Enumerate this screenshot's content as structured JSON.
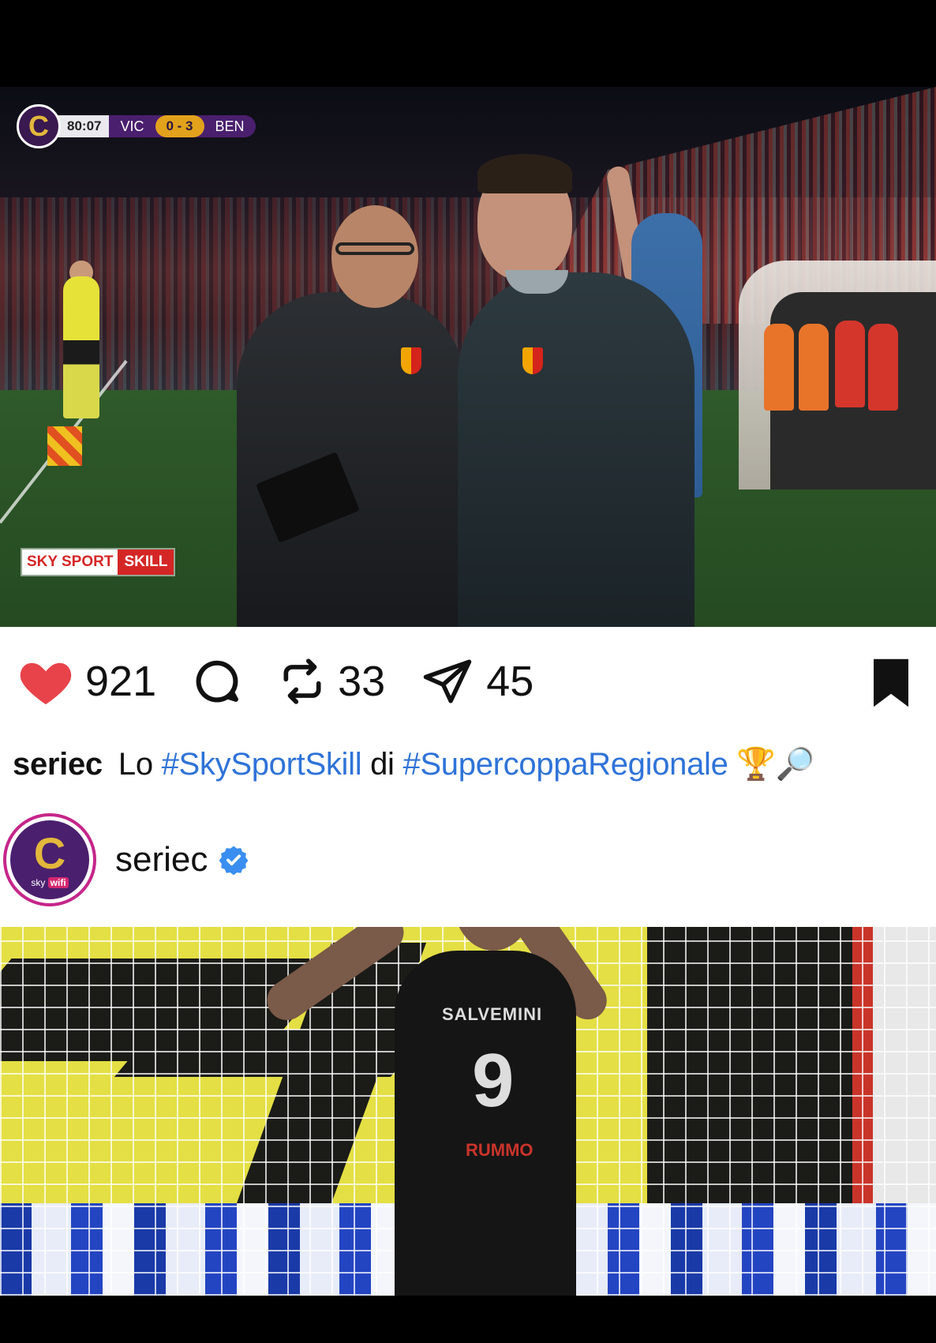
{
  "scoreboard": {
    "time": "80:07",
    "home": "VIC",
    "score": "0 - 3",
    "away": "BEN"
  },
  "broadcaster": {
    "part1": "SKY SPORT",
    "part2": "SKILL"
  },
  "actions": {
    "likes": "921",
    "reposts": "33",
    "shares": "45",
    "like_color": "#e8434a"
  },
  "caption": {
    "username": "seriec",
    "text1": "Lo",
    "hashtag1": "#SkySportSkill",
    "text2": "di",
    "hashtag2": "#SupercoppaRegionale",
    "emojis": "🏆🔎",
    "hashtag_color": "#2f73d8"
  },
  "profile": {
    "username": "seriec",
    "avatar_letter": "C",
    "avatar_sub": "sky",
    "avatar_sub2": "wifi",
    "verified": true
  },
  "photo": {
    "jersey_name": "SALVEMINI",
    "jersey_number": "9",
    "sponsor": "RUMMO"
  }
}
